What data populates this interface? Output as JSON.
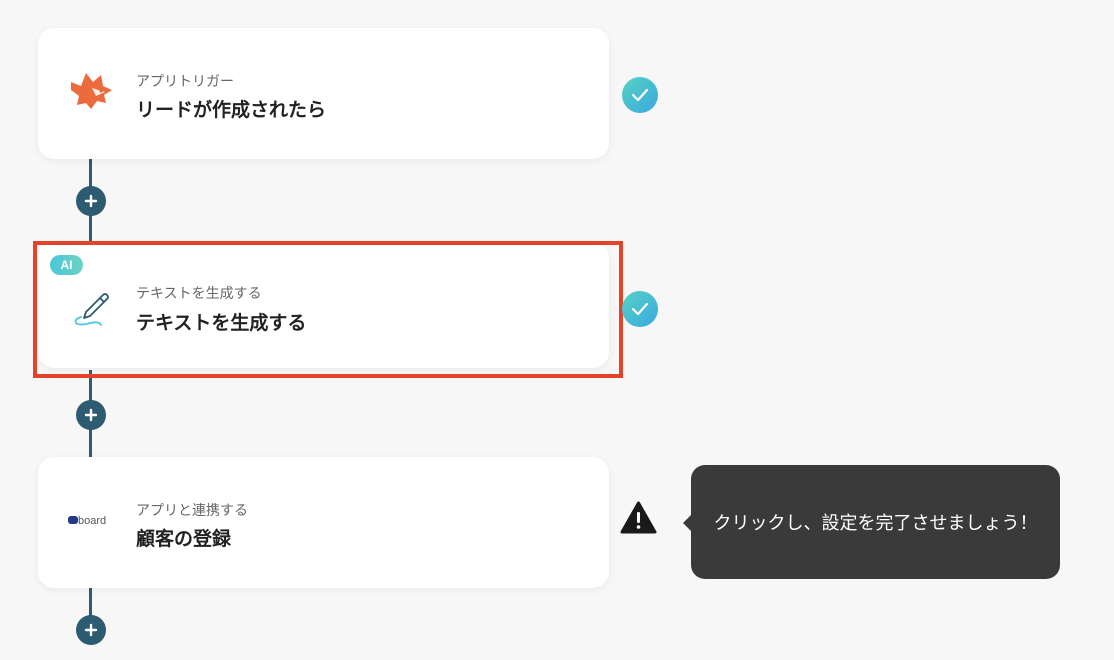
{
  "steps": [
    {
      "subtitle": "アプリトリガー",
      "title": "リードが作成されたら",
      "icon": "fox-app-icon",
      "status": "complete"
    },
    {
      "badge": "AI",
      "subtitle": "テキストを生成する",
      "title": "テキストを生成する",
      "icon": "pen-icon",
      "status": "complete",
      "highlighted": true
    },
    {
      "subtitle": "アプリと連携する",
      "title": "顧客の登録",
      "icon": "board-logo",
      "logo_text": "board",
      "status": "warning"
    }
  ],
  "tooltip": {
    "text": "クリックし、設定を完了させましょう！"
  },
  "colors": {
    "connector": "#2d5b72",
    "highlight_border": "#e2432b",
    "check_gradient_start": "#56d2c2",
    "check_gradient_end": "#3aa8e0",
    "tooltip_bg": "#3a3a3a",
    "fox_orange": "#ec6b3c"
  }
}
